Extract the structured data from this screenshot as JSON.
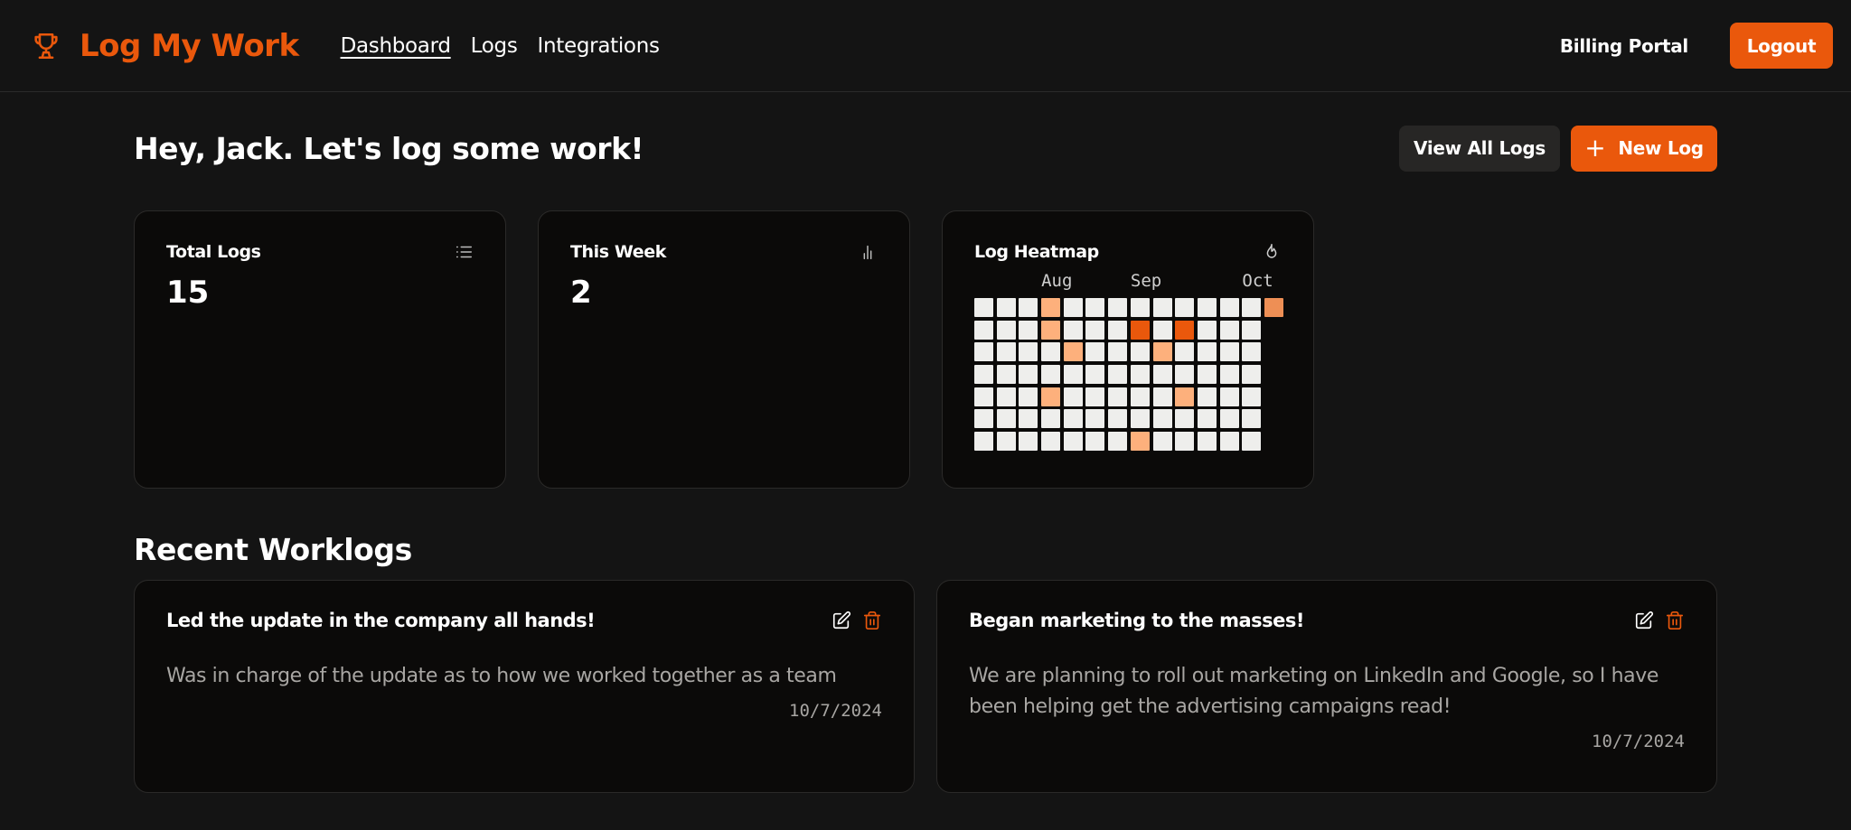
{
  "brand": {
    "name": "Log My Work",
    "icon": "trophy-icon",
    "color": "#ea580c"
  },
  "nav": [
    {
      "label": "Dashboard",
      "active": true
    },
    {
      "label": "Logs",
      "active": false
    },
    {
      "label": "Integrations",
      "active": false
    }
  ],
  "header": {
    "billing_label": "Billing Portal",
    "logout_label": "Logout"
  },
  "welcome": {
    "title": "Hey, Jack. Let's log some work!",
    "view_all_label": "View All Logs",
    "new_log_label": "New Log",
    "new_log_icon": "plus-icon"
  },
  "stats": {
    "total": {
      "label": "Total Logs",
      "value": "15",
      "icon": "list-icon"
    },
    "week": {
      "label": "This Week",
      "value": "2",
      "icon": "bar-chart-icon"
    }
  },
  "heatmap": {
    "title": "Log Heatmap",
    "icon": "flame-icon",
    "months": [
      {
        "label": "Aug",
        "column": 3
      },
      {
        "label": "Sep",
        "column": 7
      },
      {
        "label": "Oct",
        "column": 12
      }
    ],
    "colors": {
      "0": "#eeeeec",
      "1": "#fdb07c",
      "2": "#ea580c",
      "3": "#ee8f55"
    },
    "weeks": [
      [
        0,
        0,
        0,
        0,
        0,
        0,
        0
      ],
      [
        0,
        0,
        0,
        0,
        0,
        0,
        0
      ],
      [
        0,
        0,
        0,
        0,
        0,
        0,
        0
      ],
      [
        1,
        1,
        0,
        0,
        1,
        0,
        0
      ],
      [
        0,
        0,
        1,
        0,
        0,
        0,
        0
      ],
      [
        0,
        0,
        0,
        0,
        0,
        0,
        0
      ],
      [
        0,
        0,
        0,
        0,
        0,
        0,
        0
      ],
      [
        0,
        2,
        0,
        0,
        0,
        0,
        1
      ],
      [
        0,
        0,
        1,
        0,
        0,
        0,
        0
      ],
      [
        0,
        2,
        0,
        0,
        1,
        0,
        0
      ],
      [
        0,
        0,
        0,
        0,
        0,
        0,
        0
      ],
      [
        0,
        0,
        0,
        0,
        0,
        0,
        0
      ],
      [
        0,
        0,
        0,
        0,
        0,
        0,
        0
      ],
      [
        3
      ]
    ]
  },
  "recent": {
    "title": "Recent Worklogs",
    "items": [
      {
        "title": "Led the update in the company all hands!",
        "body": "Was in charge of the update as to how we worked together as a team",
        "date": "10/7/2024"
      },
      {
        "title": "Began marketing to the masses!",
        "body": "We are planning to roll out marketing on LinkedIn and Google, so I have been helping get the advertising campaigns read!",
        "date": "10/7/2024"
      }
    ]
  }
}
